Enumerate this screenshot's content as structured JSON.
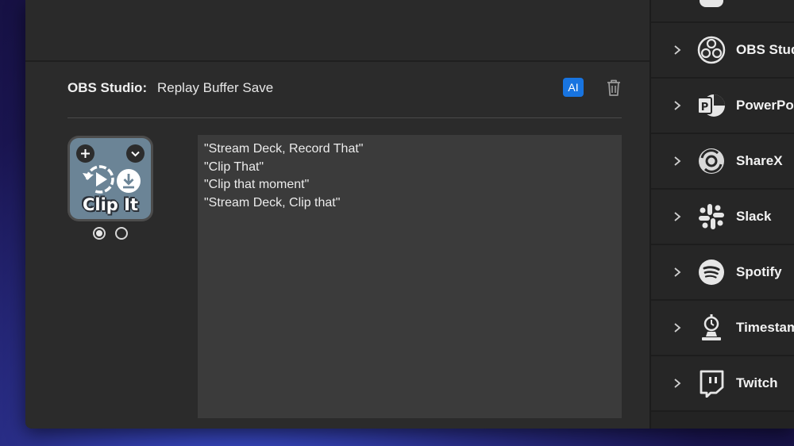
{
  "action": {
    "plugin_name": "OBS Studio:",
    "action_name": "Replay Buffer Save",
    "ai_badge": "AI"
  },
  "key": {
    "label": "Clip It",
    "background_color": "#6b8496"
  },
  "phrases": [
    "\"Stream Deck, Record That\"",
    "\"Clip That\"",
    "\"Clip that moment\"",
    "\"Stream Deck, Clip that\""
  ],
  "sidebar": {
    "items": [
      {
        "label": "OBS Studi",
        "icon": "obs-icon"
      },
      {
        "label": "PowerPoi",
        "icon": "powerpoint-icon"
      },
      {
        "label": "ShareX",
        "icon": "sharex-icon"
      },
      {
        "label": "Slack",
        "icon": "slack-icon"
      },
      {
        "label": "Spotify",
        "icon": "spotify-icon"
      },
      {
        "label": "Timestam",
        "icon": "timestamp-icon"
      },
      {
        "label": "Twitch",
        "icon": "twitch-icon"
      }
    ]
  },
  "colors": {
    "accent": "#1874e0",
    "panel": "#2b2b2b",
    "sidebar": "#232323"
  }
}
